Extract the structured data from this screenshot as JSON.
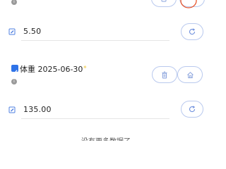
{
  "record1": {
    "value": "5.50"
  },
  "record2": {
    "title": "体重 2025-06-30",
    "value": "135.00"
  },
  "footer": {
    "text": "没有更多数据了"
  },
  "colors": {
    "accent": "#2f73e8",
    "pill_border": "#b9c9ee",
    "highlight_circle": "#e8552b"
  },
  "icons": {
    "trash": "trash-icon",
    "home": "home-icon",
    "refresh": "refresh-icon",
    "edit": "edit-icon",
    "info": "info-icon",
    "checkbox": "checkbox-checked-icon"
  }
}
